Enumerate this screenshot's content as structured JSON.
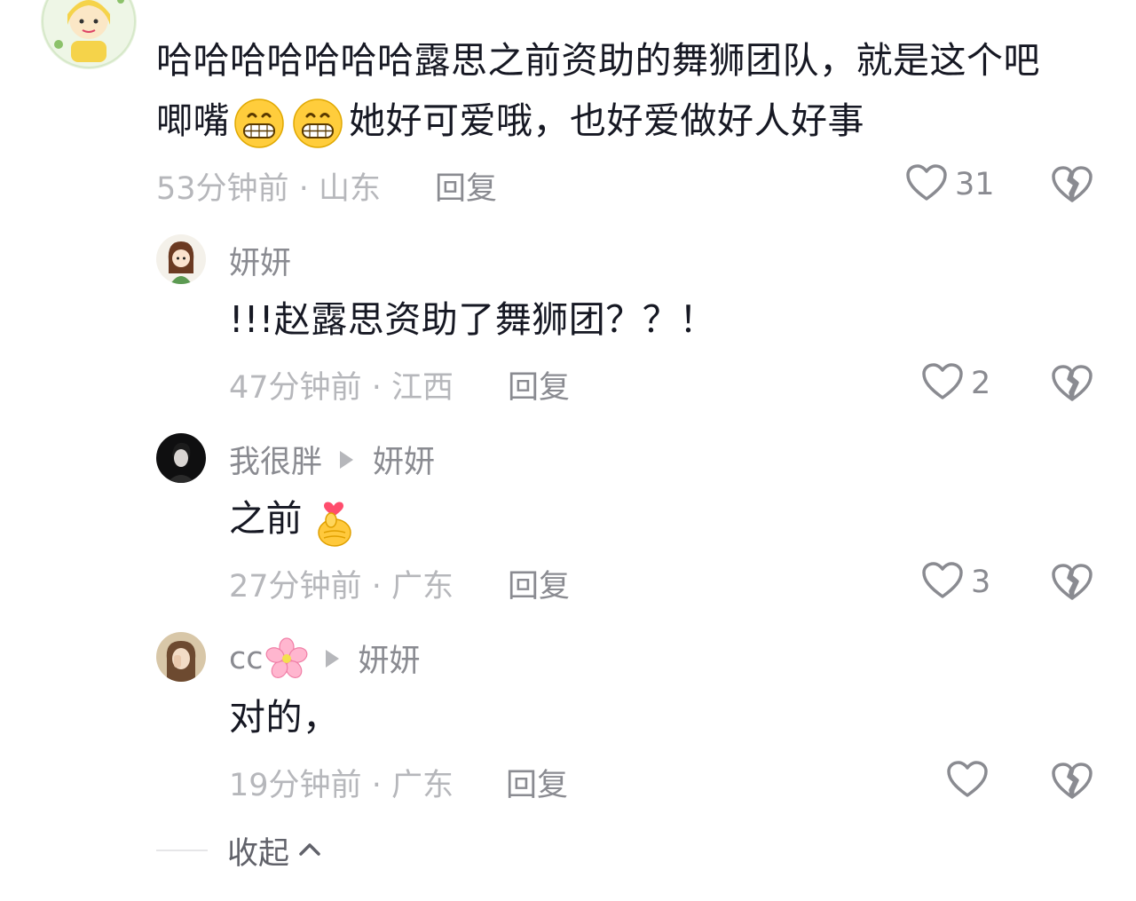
{
  "comments": [
    {
      "text_line1": "哈哈哈哈哈哈哈露思之前资助的舞狮团队，就是这个吧",
      "text_line2_a": "唧嘴",
      "text_line2_b": "她好可爱哦，也好爱做好人好事",
      "time": "53分钟前",
      "location": "山东",
      "reply": "回复",
      "likes": "31"
    }
  ],
  "replies": [
    {
      "username": "妍妍",
      "text": "!!!赵露思资助了舞狮团？？！",
      "time": "47分钟前",
      "location": "江西",
      "reply": "回复",
      "likes": "2"
    },
    {
      "username": "我很胖",
      "reply_to": "妍妍",
      "text": "之前",
      "time": "27分钟前",
      "location": "广东",
      "reply": "回复",
      "likes": "3"
    },
    {
      "username": "cc",
      "reply_to": "妍妍",
      "text": "对的，",
      "time": "19分钟前",
      "location": "广东",
      "reply": "回复",
      "likes": ""
    }
  ],
  "meta_separator": "·",
  "collapse_label": "收起",
  "icons": {
    "like": "heart-outline-icon",
    "dislike": "broken-heart-icon",
    "grin": "grinning-face-emoji",
    "finger_heart": "finger-heart-emoji",
    "flower": "cherry-blossom-emoji",
    "collapse": "chevron-up-icon"
  },
  "colors": {
    "text_primary": "#161823",
    "text_secondary": "#8a8b91",
    "text_tertiary": "#b6b7bb",
    "background": "#ffffff"
  }
}
